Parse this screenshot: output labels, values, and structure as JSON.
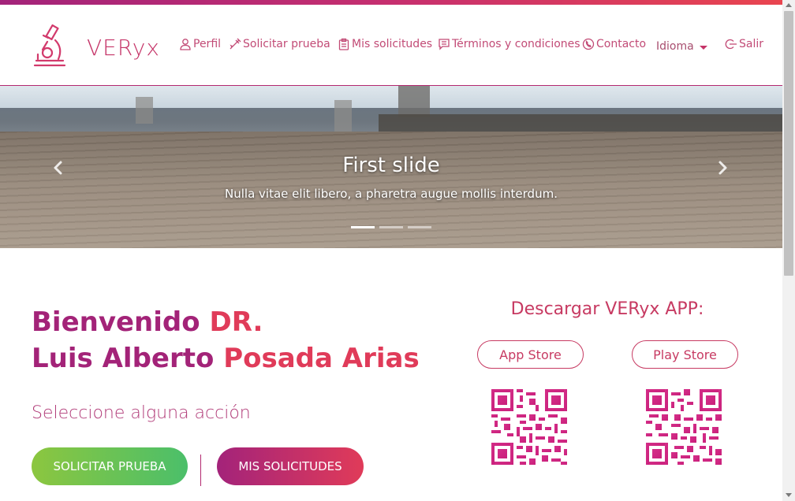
{
  "brand": {
    "name": "VERyx",
    "logo_icon": "microscope-icon"
  },
  "colors": {
    "accent_purple": "#a32378",
    "accent_red": "#e03b59",
    "green": "#8cc63f"
  },
  "nav": {
    "items": [
      {
        "label": "Perfil",
        "icon": "user-icon"
      },
      {
        "label": "Solicitar prueba",
        "icon": "syringe-icon"
      },
      {
        "label": "Mis solicitudes",
        "icon": "clipboard-icon"
      },
      {
        "label": "Términos y condiciones",
        "icon": "chat-icon"
      },
      {
        "label": "Contacto",
        "icon": "phone-icon"
      }
    ],
    "language": "Idioma",
    "logout": "Salir"
  },
  "carousel": {
    "title": "First slide",
    "caption": "Nulla vitae elit libero, a pharetra augue mollis interdum.",
    "active_index": 0,
    "slide_count": 3
  },
  "welcome": {
    "line1_a": "Bienvenido",
    "line1_b": "DR.",
    "line2_a": "Luis Alberto",
    "line2_b": "Posada Arias",
    "subtitle": "Seleccione alguna acción"
  },
  "actions": {
    "request_test": "SOLICITAR PRUEBA",
    "my_requests": "MIS SOLICITUDES"
  },
  "download": {
    "title": "Descargar VERyx APP:",
    "app_store": "App Store",
    "play_store": "Play Store"
  }
}
